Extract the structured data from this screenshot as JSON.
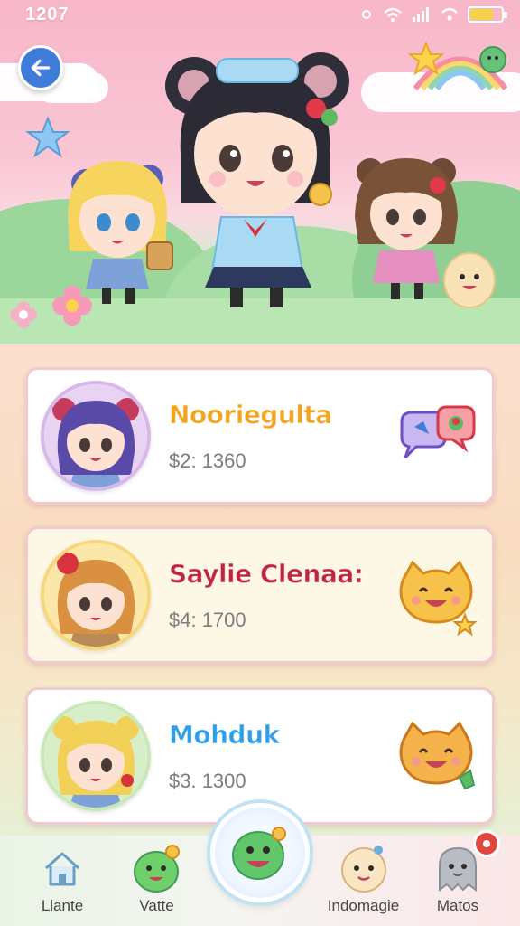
{
  "status_bar": {
    "time": "1207",
    "battery_level": 0.75
  },
  "nav_back": {
    "icon": "arrow-left-icon"
  },
  "cards": [
    {
      "name": "Nooriegulta",
      "price": "$2: 1360",
      "name_color": "#f2a41d",
      "bg_color": "#ffffff",
      "avatar_ring": "#d8b8ea",
      "badge_icon": "chat-bubbles-icon"
    },
    {
      "name": "Saylie Clenaa:",
      "price": "$4: 1700",
      "name_color": "#c0243f",
      "bg_color": "#fdf7e6",
      "avatar_ring": "#f7d77a",
      "badge_icon": "smiling-cat-icon"
    },
    {
      "name": "Mohduk",
      "price": "$3. 1300",
      "name_color": "#2f9ee6",
      "bg_color": "#ffffff",
      "avatar_ring": "#c9e8b7",
      "badge_icon": "smiling-cat-icon"
    }
  ],
  "bottom_nav": {
    "items": [
      {
        "label": "Llante",
        "icon": "home-icon"
      },
      {
        "label": "Vatte",
        "icon": "green-blob-icon"
      },
      {
        "label": "Indomagie",
        "icon": "round-face-icon"
      },
      {
        "label": "Matos",
        "icon": "grey-ghost-icon"
      }
    ],
    "center_icon": "happy-green-blob-icon"
  },
  "colors": {
    "accent_blue": "#3f7bd8",
    "notification_red": "#e0473e"
  }
}
